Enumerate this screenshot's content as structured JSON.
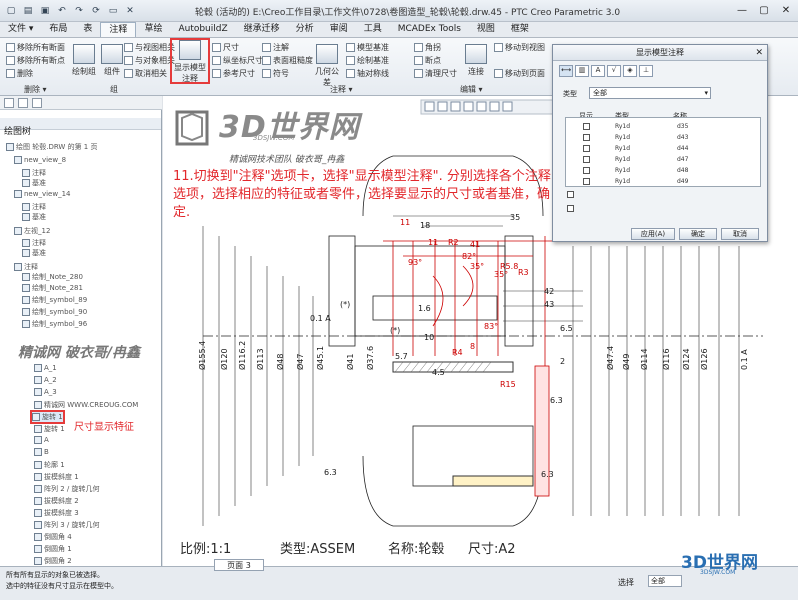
{
  "window": {
    "title": "轮毂 (活动的) E:\\Creo工作目录\\工作文件\\0728\\卷图造型_轮毂\\轮毂.drw.45 - PTC Creo Parametric 3.0"
  },
  "menu": {
    "tabs": [
      "文件 ▾",
      "布局",
      "表",
      "注释",
      "草绘",
      "继承迁移",
      "分析",
      "审阅",
      "工具",
      "视图",
      "框架"
    ],
    "extra_tabs": [
      "AutobuildZ",
      "MCADEx Tools"
    ],
    "active_tab": "注释"
  },
  "ribbon": {
    "col1": [
      "移除所有断面",
      "移除所有断点",
      "删除"
    ],
    "col2_big": [
      "绘制组",
      "组件"
    ],
    "col3": [
      "与视图相关",
      "与对象相关",
      "取消相关"
    ],
    "show_model_annotations": "显示模型注释",
    "col5": [
      "尺寸",
      "纵坐标尺寸",
      "参考尺寸"
    ],
    "col6": [
      "注解",
      "表面粗糙度",
      "符号"
    ],
    "col7_big": [
      "几何公差"
    ],
    "col8": [
      "模型基准",
      "绘制基准",
      "轴对称线"
    ],
    "col9": [
      "角拐",
      "断点",
      "清理尺寸"
    ],
    "col10_big": [
      "连接"
    ],
    "col11": [
      "移动到视图",
      "移动到页面"
    ],
    "groups": [
      "删除 ▾",
      "组",
      "注释 ▾",
      "编辑 ▾"
    ]
  },
  "left_panel": {
    "title": "绘图树",
    "items": [
      "绘图 轮毂.DRW 的第 1 页",
      "new_view_8",
      "注释",
      "基准",
      "new_view_14",
      "注释",
      "基准",
      "左视_12",
      "注释",
      "基准",
      "注释",
      "绘制_Note_280",
      "绘制_Note_281",
      "绘制_symbol_89",
      "绘制_symbol_90",
      "绘制_symbol_96"
    ],
    "model_items": [
      "A_1",
      "A_2",
      "A_3",
      "精诚网 WWW.CREOUG.COM",
      "旋转 1",
      "旋转 1",
      "A",
      "B",
      "轮廓 1",
      "拔模斜度 1",
      "阵列 2 / 旋转几何",
      "拔模斜度 2",
      "拔模斜度 3",
      "阵列 3 / 旋转几何",
      "倒圆角 4",
      "倒圆角 1",
      "倒圆角 2"
    ],
    "highlight_label": "尺寸显示特征"
  },
  "instruction": "11.切换到\"注释\"选项卡，选择\"显示模型注释\". 分别选择各个注释选项，选择相应的特征或者零件，选择要显示的尺寸或者基准，确定.",
  "watermark": {
    "logo": "3D世界网",
    "sub": "3DSJW.COM",
    "team": "精诚网技术团队 破衣哥_冉鑫",
    "left": "精诚网 破衣哥/冉鑫"
  },
  "dialog": {
    "title": "显示模型注释",
    "type_label": "类型",
    "type_value": "全部",
    "headers": [
      "显示",
      "类型",
      "名称"
    ],
    "rows": [
      {
        "type": "Ry1d",
        "name": "d35"
      },
      {
        "type": "Ry1d",
        "name": "d43"
      },
      {
        "type": "Ry1d",
        "name": "d44"
      },
      {
        "type": "Ry1d",
        "name": "d47"
      },
      {
        "type": "Ry1d",
        "name": "d48"
      },
      {
        "type": "Ry1d",
        "name": "d49"
      }
    ],
    "buttons": [
      "应用(A)",
      "确定",
      "取消"
    ]
  },
  "drawing": {
    "dims_black": [
      "35",
      "18",
      "43",
      "42",
      "6.5",
      "10",
      "6.3",
      "6.3",
      "Ø155.4",
      "Ø120",
      "Ø116.2",
      "Ø113",
      "Ø48",
      "Ø47",
      "Ø45.1",
      "Ø41",
      "Ø37.6",
      "Ø47.4",
      "Ø49",
      "Ø114",
      "Ø116",
      "Ø124",
      "Ø126",
      "0.1 A",
      "0.1 A",
      "(*)",
      "(*)",
      "1.6",
      "4.5",
      "5.7",
      "2",
      "6.3"
    ],
    "dims_red": [
      "11",
      "11",
      "R2",
      "41",
      "82°",
      "R5.8",
      "35°",
      "35°",
      "R3",
      "93°",
      "83°",
      "8",
      "R4",
      "R15"
    ],
    "bottom": {
      "scale": "比例:1:1",
      "type": "类型:ASSEM",
      "name": "名称:轮毂",
      "size": "尺寸:A2"
    }
  },
  "status": {
    "messages": [
      "所有所有显示的对象已被选择。",
      "选中的特征没有尺寸显示在模型中。"
    ],
    "page_tab": "页面 3",
    "select_label": "选择",
    "filter": "全部"
  },
  "colors": {
    "accent_red": "#e2272b",
    "drawing_red": "#cc0000",
    "brand_blue": "#2a6fb2"
  }
}
